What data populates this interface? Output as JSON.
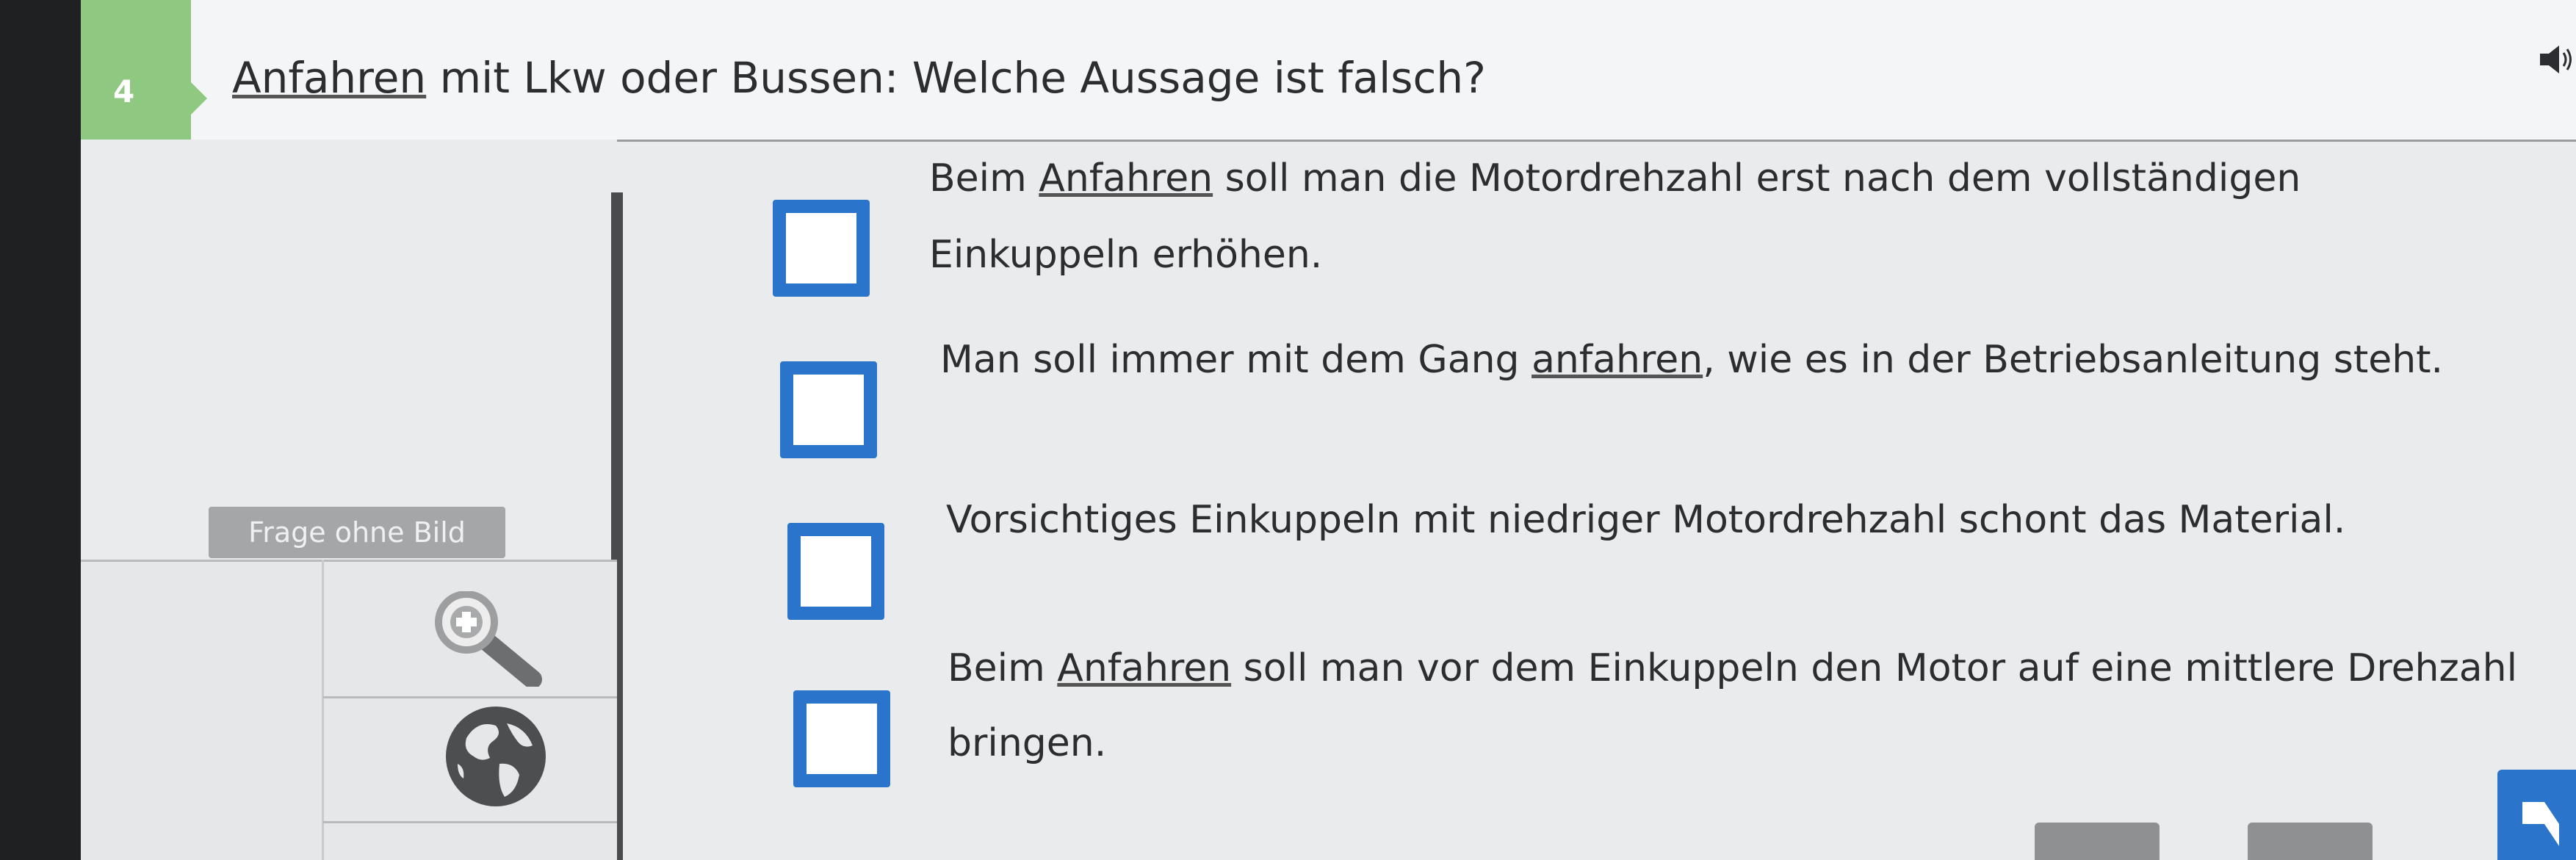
{
  "question": {
    "number": "4",
    "text_part1": "Anfahren",
    "text_part2": " mit Lkw oder Bussen: Welche Aussage ist falsch?"
  },
  "badge": {
    "label": "Frage ohne Bild"
  },
  "answers": [
    {
      "line1_pre": "Beim ",
      "line1_u": "Anfahren",
      "line1_post": " soll man die Motordrehzahl erst nach dem vollständigen",
      "line2": "Einkuppeln erhöhen.",
      "checked": false
    },
    {
      "line1_pre": "Man soll immer mit dem Gang ",
      "line1_u": "anfahren",
      "line1_post": ", wie es in der Betriebsanleitung steht.",
      "line2": "",
      "checked": false
    },
    {
      "line1_pre": "Vorsichtiges Einkuppeln mit niedriger Motordrehzahl schont das Material.",
      "line1_u": "",
      "line1_post": "",
      "line2": "",
      "checked": false
    },
    {
      "line1_pre": "Beim ",
      "line1_u": "Anfahren",
      "line1_post": " soll man vor dem Einkuppeln den Motor auf eine mittlere Drehzahl",
      "line2": "bringen.",
      "checked": false
    }
  ],
  "icons": {
    "speaker": "speaker-icon",
    "zoom": "zoom-in-icon",
    "globe": "globe-icon",
    "next": "next-arrow-icon"
  },
  "colors": {
    "accent_green": "#8fc880",
    "checkbox_blue": "#2b74cc",
    "badge_grey": "#a5a6a8"
  }
}
